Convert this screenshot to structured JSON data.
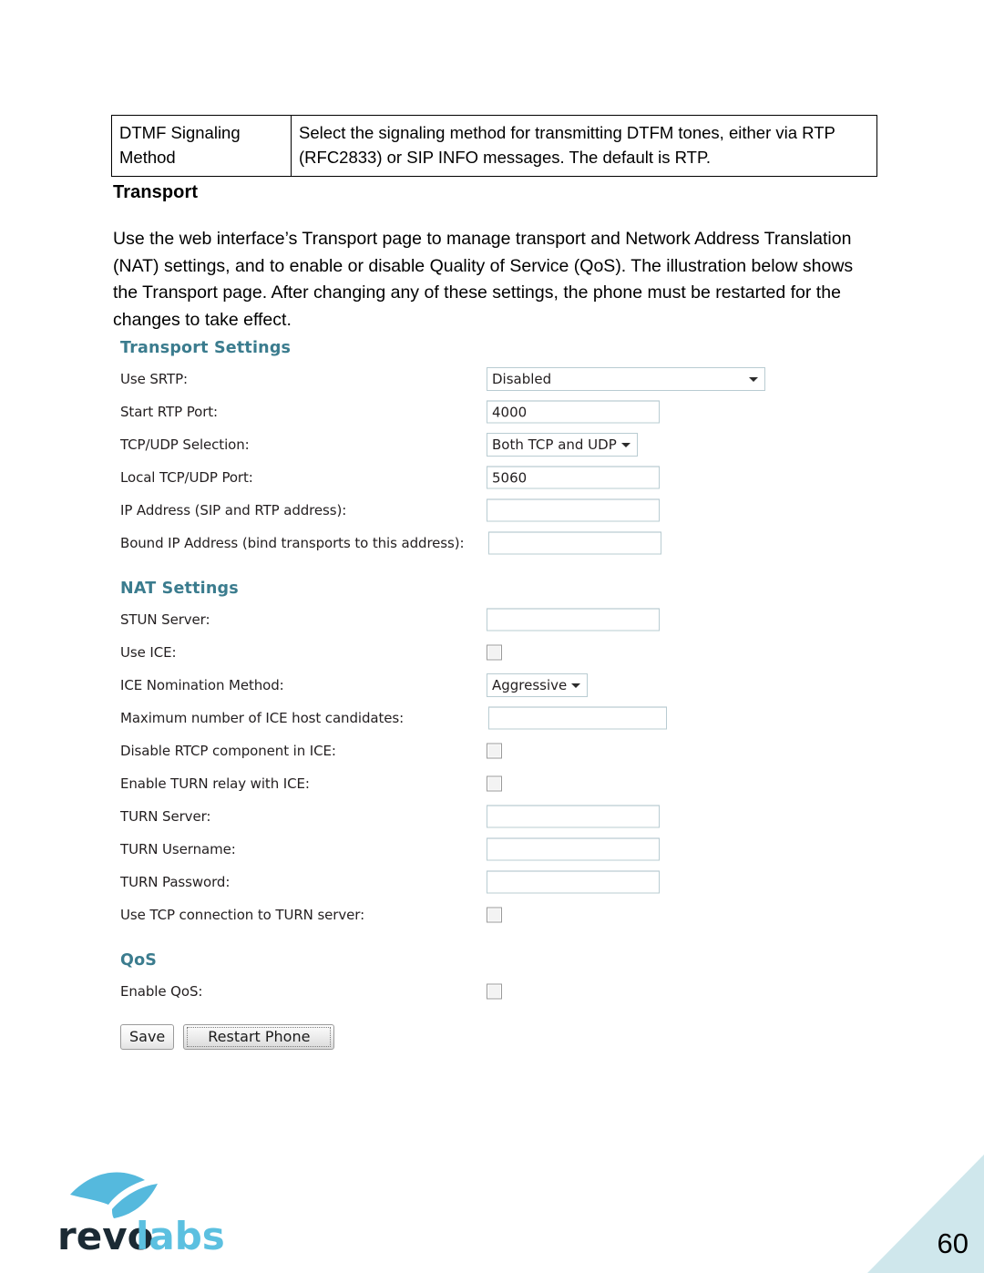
{
  "doc": {
    "definition_table": {
      "rows": [
        {
          "term": "DTMF Signaling Method",
          "description": "Select the signaling method for transmitting DTFM tones, either via RTP (RFC2833) or SIP INFO messages. The default is RTP."
        }
      ]
    },
    "section_heading": "Transport",
    "paragraph": "Use the web interface’s Transport page to manage transport and Network Address Translation (NAT) settings, and to enable or disable Quality of Service (QoS). The illustration below shows the Transport page. After changing any of these settings, the phone must be restarted for the changes to take effect.",
    "page_number": "60",
    "logo": {
      "text_dark": "revo",
      "text_light": "labs",
      "color_dark": "#1b2a34",
      "color_light": "#5cc0e0",
      "swoosh_color": "#55b9dd"
    },
    "page_corner_color": "#cfe7ec"
  },
  "webui": {
    "accent_color": "#3b7c8e",
    "transport_settings": {
      "title": "Transport Settings",
      "fields": [
        {
          "label": "Use SRTP:",
          "type": "select",
          "value": "Disabled"
        },
        {
          "label": "Start RTP Port:",
          "type": "text",
          "value": "4000"
        },
        {
          "label": "TCP/UDP Selection:",
          "type": "select-auto",
          "value": "Both TCP and UDP"
        },
        {
          "label": "Local TCP/UDP Port:",
          "type": "text",
          "value": "5060"
        },
        {
          "label": "IP Address (SIP and RTP address):",
          "type": "text",
          "value": ""
        },
        {
          "label": "Bound IP Address (bind transports to this address):",
          "type": "text",
          "value": ""
        }
      ]
    },
    "nat_settings": {
      "title": "NAT Settings",
      "fields": [
        {
          "label": "STUN Server:",
          "type": "text",
          "value": ""
        },
        {
          "label": "Use ICE:",
          "type": "checkbox",
          "checked": false
        },
        {
          "label": "ICE Nomination Method:",
          "type": "select-auto",
          "value": "Aggressive"
        },
        {
          "label": "Maximum number of ICE host candidates:",
          "type": "text",
          "value": ""
        },
        {
          "label": "Disable RTCP component in ICE:",
          "type": "checkbox",
          "checked": false
        },
        {
          "label": "Enable TURN relay with ICE:",
          "type": "checkbox",
          "checked": false
        },
        {
          "label": "TURN Server:",
          "type": "text",
          "value": ""
        },
        {
          "label": "TURN Username:",
          "type": "text",
          "value": ""
        },
        {
          "label": "TURN Password:",
          "type": "text",
          "value": ""
        },
        {
          "label": "Use TCP connection to TURN server:",
          "type": "checkbox",
          "checked": false
        }
      ]
    },
    "qos": {
      "title": "QoS",
      "fields": [
        {
          "label": "Enable QoS:",
          "type": "checkbox",
          "checked": false
        }
      ]
    },
    "buttons": {
      "save": "Save",
      "restart": "Restart Phone"
    }
  }
}
